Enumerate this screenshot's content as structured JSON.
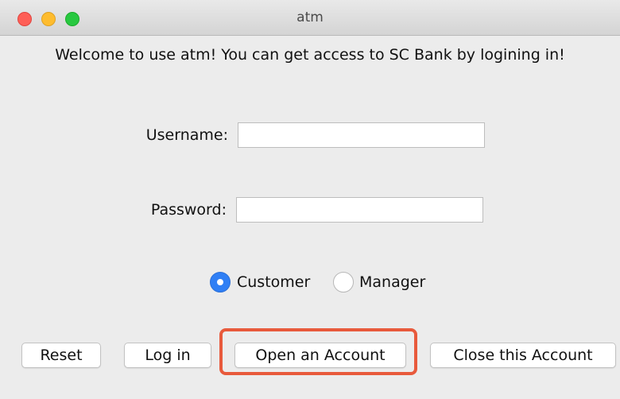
{
  "window": {
    "title": "atm"
  },
  "welcome": "Welcome to use atm! You can get access to SC Bank by logining in!",
  "form": {
    "username_label": "Username:",
    "username_value": "",
    "password_label": "Password:",
    "password_value": ""
  },
  "role": {
    "selected": "Customer",
    "options": [
      {
        "label": "Customer",
        "checked": true
      },
      {
        "label": "Manager",
        "checked": false
      }
    ]
  },
  "buttons": {
    "reset": "Reset",
    "login": "Log in",
    "open_account": "Open an Account",
    "close_account": "Close this Account"
  },
  "colors": {
    "accent": "#2f7ff5",
    "highlight": "#e85a3c"
  }
}
